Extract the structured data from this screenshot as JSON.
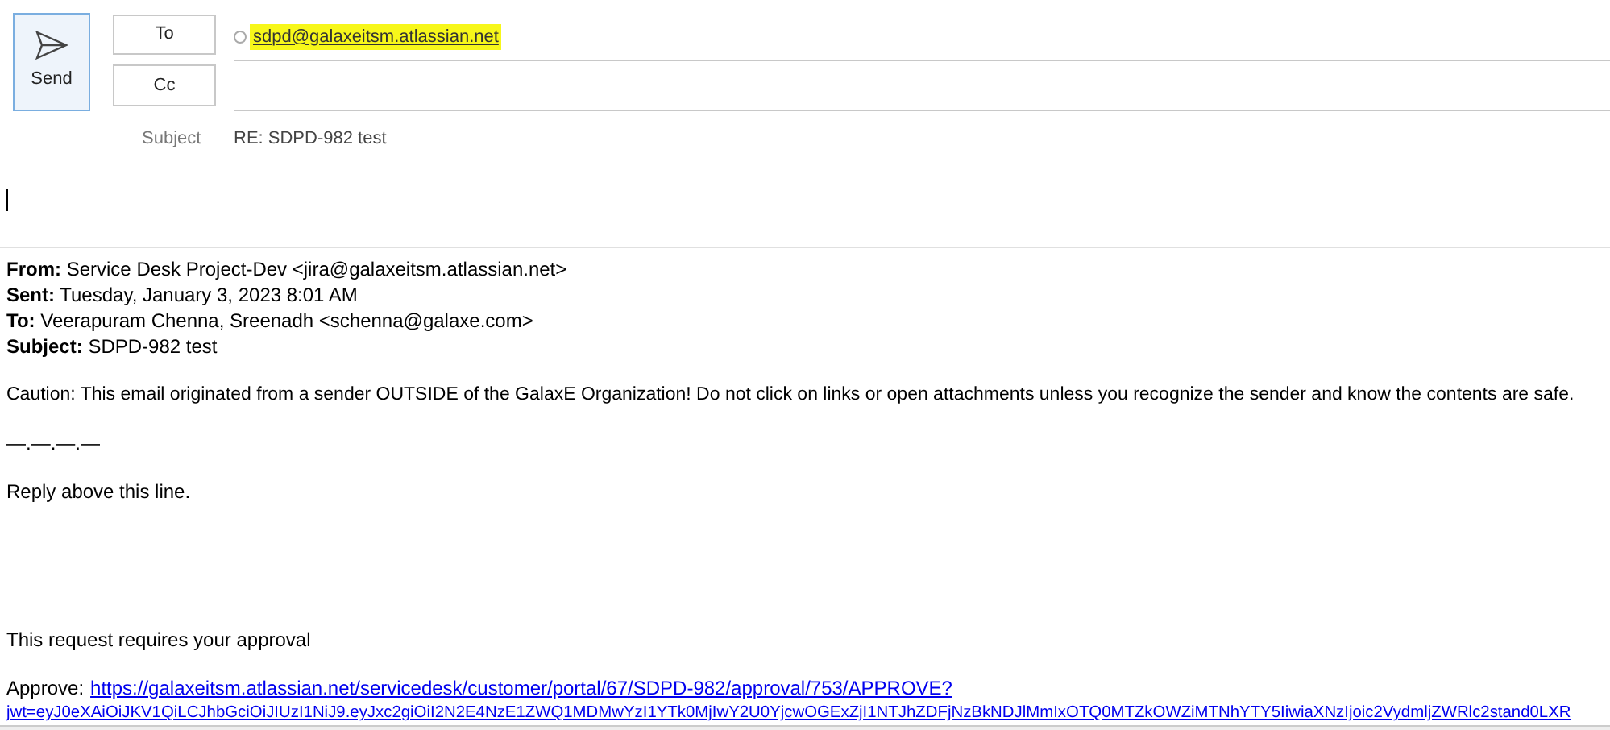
{
  "send_button": {
    "label": "Send"
  },
  "to_button": {
    "label": "To"
  },
  "cc_button": {
    "label": "Cc"
  },
  "recipients": [
    {
      "address": "sdpd@galaxeitsm.atlassian.net",
      "highlighted": true
    }
  ],
  "subject": {
    "label": "Subject",
    "value": "RE: SDPD-982 test"
  },
  "quoted_header": [
    {
      "label": "From:",
      "value": "Service Desk Project-Dev <jira@galaxeitsm.atlassian.net>"
    },
    {
      "label": "Sent:",
      "value": "Tuesday, January 3, 2023 8:01 AM"
    },
    {
      "label": "To:",
      "value": "Veerapuram Chenna, Sreenadh <schenna@galaxe.com>"
    },
    {
      "label": "Subject:",
      "value": "SDPD-982 test"
    }
  ],
  "caution": "Caution: This email originated from a sender OUTSIDE of the GalaxE Organization! Do not click on links or open attachments unless you recognize the sender and know the contents are safe.",
  "separator": "—.—.—.—",
  "reply_note": "Reply above this line.",
  "request_note": "This request requires your approval",
  "approve": {
    "label": "Approve:",
    "link_lines": [
      "https://galaxeitsm.atlassian.net/servicedesk/customer/portal/67/SDPD-982/approval/753/APPROVE?",
      "jwt=eyJ0eXAiOiJKV1QiLCJhbGciOiJIUzI1NiJ9.eyJxc2giOiI2N2E4NzE1ZWQ1MDMwYzI1YTk0MjIwY2U0YjcwOGExZjI1NTJhZDFjNzBkNDJlMmIxOTQ0MTZkOWZiMTNhYTY5IiwiaXNzIjoic2VydmljZWRlc2stand0LXR"
    ]
  }
}
